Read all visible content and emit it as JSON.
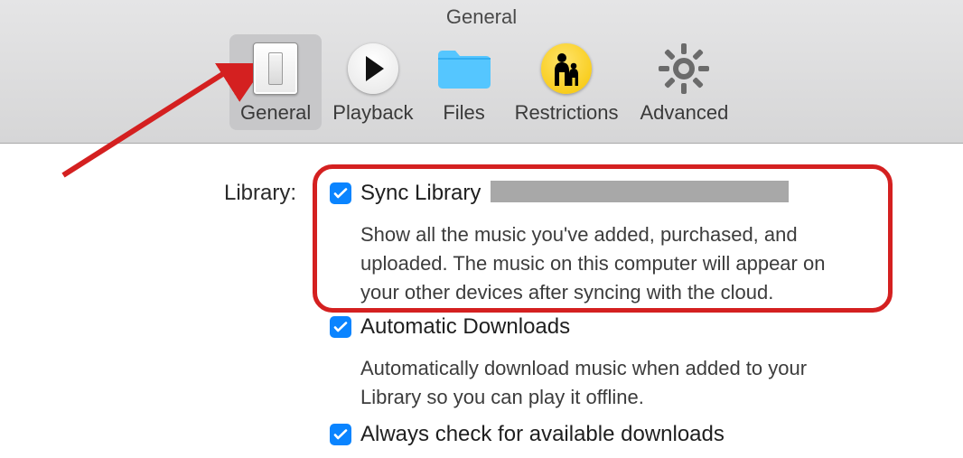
{
  "window": {
    "title": "General"
  },
  "tabs": [
    {
      "id": "general",
      "label": "General"
    },
    {
      "id": "playback",
      "label": "Playback"
    },
    {
      "id": "files",
      "label": "Files"
    },
    {
      "id": "restrictions",
      "label": "Restrictions"
    },
    {
      "id": "advanced",
      "label": "Advanced"
    }
  ],
  "section_label": "Library:",
  "options": {
    "sync_library": {
      "checked": true,
      "title": "Sync Library",
      "description": "Show all the music you've added, purchased, and uploaded. The music on this computer will appear on your other devices after syncing with the cloud."
    },
    "automatic_downloads": {
      "checked": true,
      "title": "Automatic Downloads",
      "description": "Automatically download music when added to your Library so you can play it offline."
    },
    "always_check_downloads": {
      "checked": true,
      "title": "Always check for available downloads"
    }
  }
}
